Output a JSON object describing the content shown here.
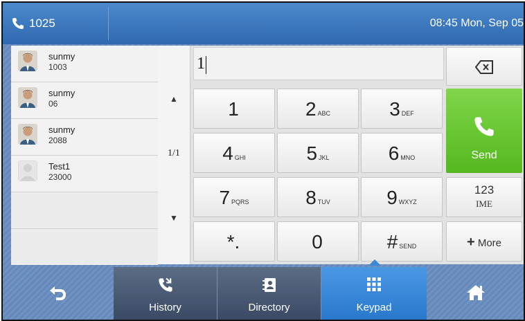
{
  "status_bar": {
    "extension": "1025",
    "datetime": "08:45 Mon, Sep 05"
  },
  "contacts": [
    {
      "name": "sunmy",
      "number": "1003",
      "avatar": "photo"
    },
    {
      "name": "sunmy",
      "number": "06",
      "avatar": "photo"
    },
    {
      "name": "sunmy",
      "number": "2088",
      "avatar": "photo"
    },
    {
      "name": "Test1",
      "number": "23000",
      "avatar": "placeholder"
    }
  ],
  "pager": {
    "up_icon": "triangle-up-icon",
    "page": "1/1",
    "down_icon": "triangle-down-icon"
  },
  "dial_input": {
    "value": "1"
  },
  "keypad": [
    {
      "digit": "1",
      "sub": ""
    },
    {
      "digit": "2",
      "sub": "ABC"
    },
    {
      "digit": "3",
      "sub": "DEF"
    },
    {
      "digit": "4",
      "sub": "GHI"
    },
    {
      "digit": "5",
      "sub": "JKL"
    },
    {
      "digit": "6",
      "sub": "MNO"
    },
    {
      "digit": "7",
      "sub": "PQRS"
    },
    {
      "digit": "8",
      "sub": "TUV"
    },
    {
      "digit": "9",
      "sub": "WXYZ"
    },
    {
      "digit": "*.",
      "sub": ""
    },
    {
      "digit": "0",
      "sub": ""
    },
    {
      "digit": "#",
      "sub": "SEND"
    }
  ],
  "side_keys": {
    "backspace_icon": "backspace-icon",
    "send_label": "Send",
    "ime_top": "123",
    "ime_bottom": "IME",
    "more_label": "More"
  },
  "bottom_nav": {
    "back_icon": "back-arrow-icon",
    "history_label": "History",
    "directory_label": "Directory",
    "keypad_label": "Keypad",
    "home_icon": "home-icon"
  },
  "colors": {
    "top_bar": "#3b78bf",
    "send_key": "#6cc837",
    "active_tab": "#3a8ad8",
    "dark_tab": "#48586f"
  }
}
